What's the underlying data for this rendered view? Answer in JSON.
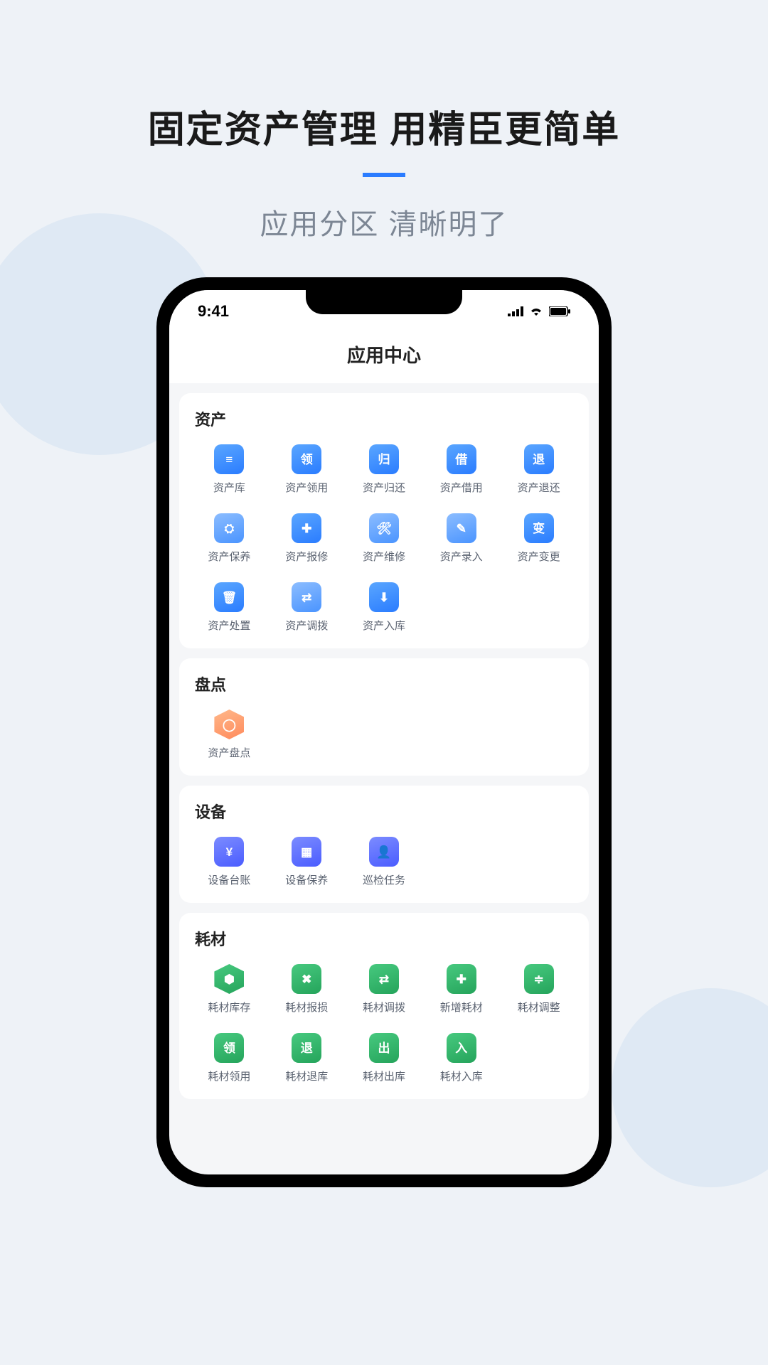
{
  "hero": {
    "title": "固定资产管理  用精臣更简单",
    "subtitle": "应用分区 清晰明了"
  },
  "status": {
    "time": "9:41"
  },
  "page": {
    "title": "应用中心"
  },
  "sections": {
    "assets": {
      "title": "资产",
      "items": [
        {
          "label": "资产库",
          "sym": "≡"
        },
        {
          "label": "资产领用",
          "sym": "领"
        },
        {
          "label": "资产归还",
          "sym": "归"
        },
        {
          "label": "资产借用",
          "sym": "借"
        },
        {
          "label": "资产退还",
          "sym": "退"
        },
        {
          "label": "资产保养",
          "sym": "⛭"
        },
        {
          "label": "资产报修",
          "sym": "✚"
        },
        {
          "label": "资产维修",
          "sym": "🛠"
        },
        {
          "label": "资产录入",
          "sym": "✎"
        },
        {
          "label": "资产变更",
          "sym": "变"
        },
        {
          "label": "资产处置",
          "sym": "🗑"
        },
        {
          "label": "资产调拨",
          "sym": "⇄"
        },
        {
          "label": "资产入库",
          "sym": "⬇"
        }
      ]
    },
    "inventory": {
      "title": "盘点",
      "items": [
        {
          "label": "资产盘点",
          "sym": "◯"
        }
      ]
    },
    "equipment": {
      "title": "设备",
      "items": [
        {
          "label": "设备台账",
          "sym": "¥"
        },
        {
          "label": "设备保养",
          "sym": "▦"
        },
        {
          "label": "巡检任务",
          "sym": "👤"
        }
      ]
    },
    "consumables": {
      "title": "耗材",
      "items": [
        {
          "label": "耗材库存",
          "sym": "⬢"
        },
        {
          "label": "耗材报损",
          "sym": "✖"
        },
        {
          "label": "耗材调拨",
          "sym": "⇄"
        },
        {
          "label": "新增耗材",
          "sym": "✚"
        },
        {
          "label": "耗材调整",
          "sym": "≑"
        },
        {
          "label": "耗材领用",
          "sym": "领"
        },
        {
          "label": "耗材退库",
          "sym": "退"
        },
        {
          "label": "耗材出库",
          "sym": "出"
        },
        {
          "label": "耗材入库",
          "sym": "入"
        }
      ]
    }
  }
}
